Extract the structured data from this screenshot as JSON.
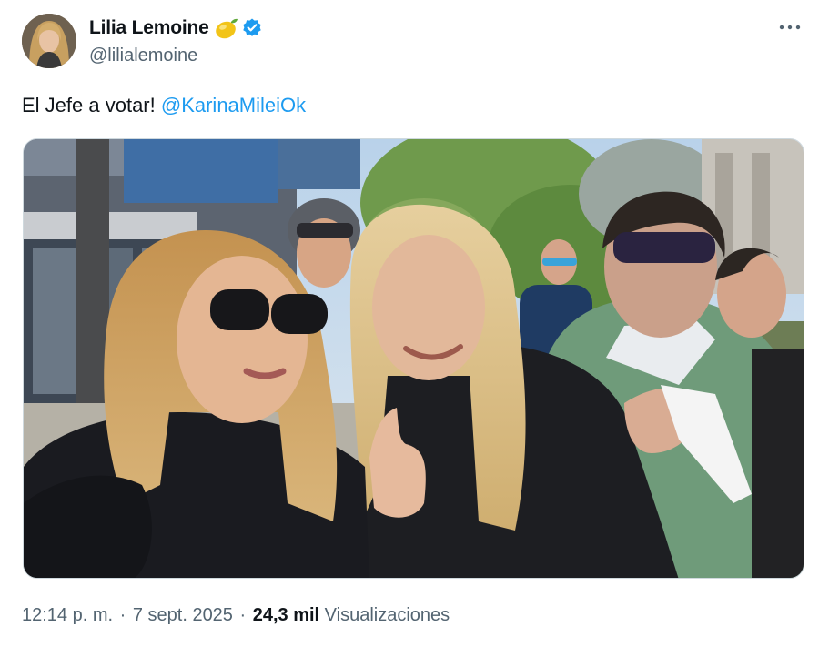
{
  "author": {
    "display_name": "Lilia Lemoine",
    "handle": "@lilialemoine",
    "emoji_icon": "lemon-icon",
    "verified_icon": "verified-badge-icon",
    "verified_color": "#1d9bf0"
  },
  "menu": {
    "more_icon": "more-horizontal-icon"
  },
  "post": {
    "text": "El Jefe a votar! ",
    "mention": "@KarinaMileiOk",
    "mention_color": "#1d9bf0"
  },
  "media": {
    "type": "photo",
    "icon": "photo-selfie"
  },
  "meta": {
    "time": "12:14 p. m.",
    "separator": " · ",
    "date": "7 sept. 2025",
    "views_count": "24,3 mil",
    "views_label": "Visualizaciones"
  },
  "colors": {
    "text_primary": "#0f1419",
    "text_secondary": "#536471",
    "border": "#cfd9de"
  }
}
